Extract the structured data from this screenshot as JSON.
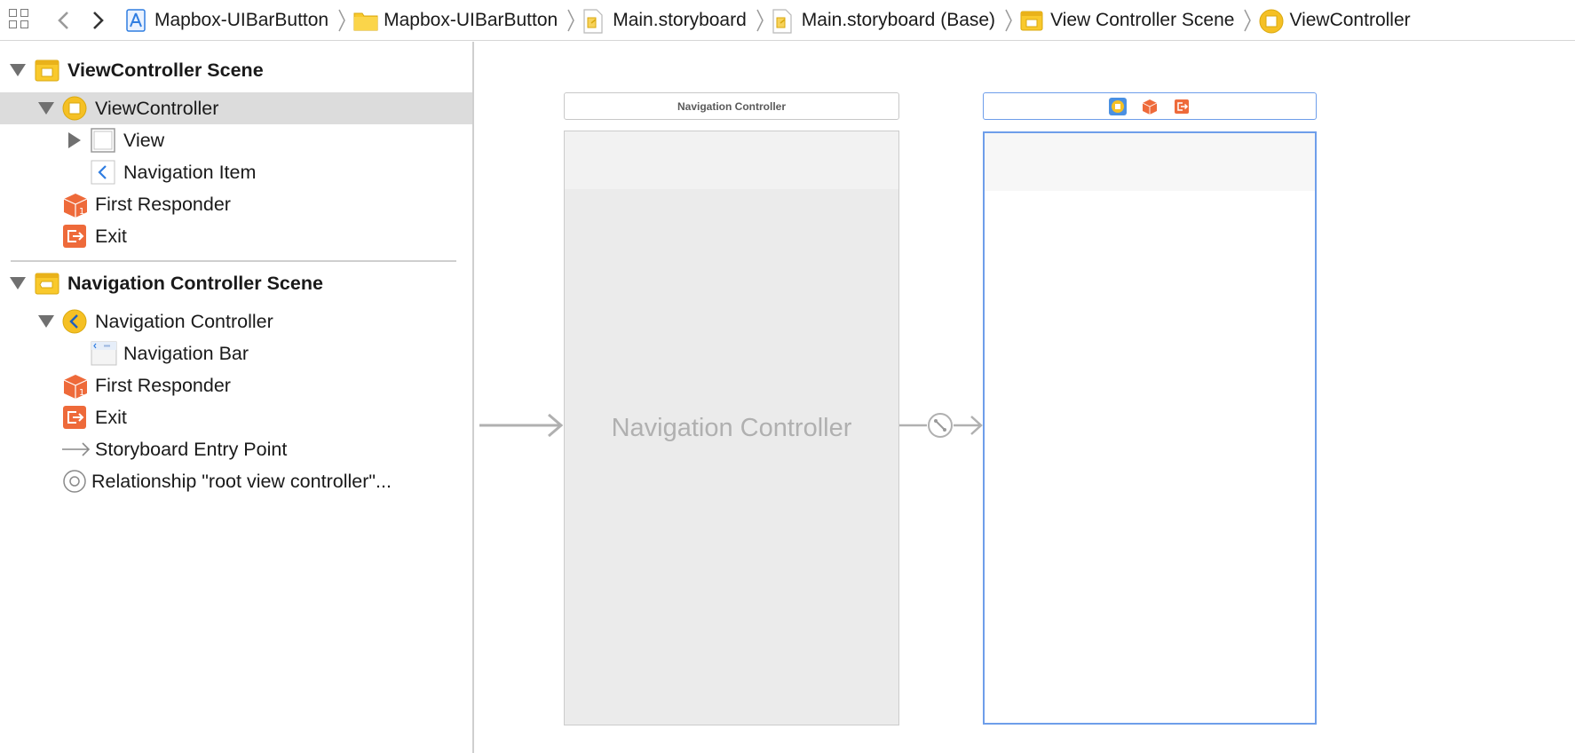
{
  "jumpbar": {
    "breadcrumbs": [
      {
        "label": "Mapbox-UIBarButton",
        "icon": "xcode-project-icon"
      },
      {
        "label": "Mapbox-UIBarButton",
        "icon": "folder-icon"
      },
      {
        "label": "Main.storyboard",
        "icon": "storyboard-file-icon"
      },
      {
        "label": "Main.storyboard (Base)",
        "icon": "storyboard-file-icon"
      },
      {
        "label": "View Controller Scene",
        "icon": "scene-icon"
      },
      {
        "label": "ViewController",
        "icon": "view-controller-icon"
      }
    ]
  },
  "outline": {
    "scene1": {
      "title": "ViewController Scene",
      "items": [
        {
          "label": "ViewController",
          "icon": "view-controller-icon",
          "selected": true
        },
        {
          "label": "View",
          "icon": "view-icon"
        },
        {
          "label": "Navigation Item",
          "icon": "navigation-item-icon"
        },
        {
          "label": "First Responder",
          "icon": "first-responder-icon"
        },
        {
          "label": "Exit",
          "icon": "exit-icon"
        }
      ]
    },
    "scene2": {
      "title": "Navigation Controller Scene",
      "items": [
        {
          "label": "Navigation Controller",
          "icon": "navigation-controller-icon"
        },
        {
          "label": "Navigation Bar",
          "icon": "navigation-bar-icon"
        },
        {
          "label": "First Responder",
          "icon": "first-responder-icon"
        },
        {
          "label": "Exit",
          "icon": "exit-icon"
        },
        {
          "label": "Storyboard Entry Point",
          "icon": "entry-arrow-icon"
        },
        {
          "label": "Relationship \"root view controller\"...",
          "icon": "relationship-icon"
        }
      ]
    }
  },
  "canvas": {
    "nav_scene_bar_label": "Navigation Controller",
    "nav_frame_title": "Navigation Controller",
    "colors": {
      "selection": "#6e9eea",
      "accent_yellow": "#f5c024",
      "accent_orange": "#ee6a3a"
    }
  }
}
